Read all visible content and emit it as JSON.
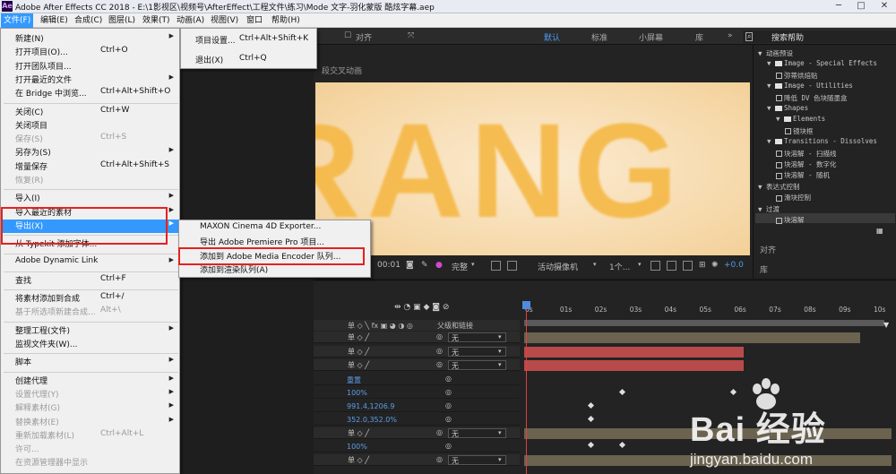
{
  "titlebar": {
    "logo": "Ae",
    "title": "Adobe After Effects CC 2018 - E:\\1影视区\\视频号\\AfterEffect\\工程文件\\练习\\Mode 文字-羽化蒙版 酷炫字幕.aep",
    "min": "─",
    "max": "□",
    "close": "✕"
  },
  "menubar": [
    "文件(F)",
    "编辑(E)",
    "合成(C)",
    "图层(L)",
    "效果(T)",
    "动画(A)",
    "视图(V)",
    "窗口",
    "帮助(H)"
  ],
  "toolbar": {
    "align": "对齐",
    "workspaces": [
      "默认",
      "标准",
      "小屏幕",
      "库"
    ],
    "search_placeholder": "搜索帮助"
  },
  "comp": {
    "title": "段交叉动画",
    "canvas_text": "RANG",
    "footer": {
      "time": "00:01",
      "quality": "完整",
      "camera": "活动摄像机",
      "view": "1个...",
      "exposure": "+0.0"
    }
  },
  "right_panel": {
    "items": [
      {
        "text": "▼ 动画预设",
        "level": 0,
        "kind": "none"
      },
      {
        "text": "Image - Special Effects",
        "level": 1,
        "kind": "folder",
        "arrow": "▼"
      },
      {
        "text": "弥蒂烘焙贴",
        "level": 2,
        "kind": "preset"
      },
      {
        "text": "Image - Utilities",
        "level": 1,
        "kind": "folder",
        "arrow": "▼"
      },
      {
        "text": "降低 DV 色块随墨盒",
        "level": 2,
        "kind": "preset"
      },
      {
        "text": "Shapes",
        "level": 1,
        "kind": "folder",
        "arrow": "▼"
      },
      {
        "text": "Elements",
        "level": 2,
        "kind": "folder",
        "arrow": "▼"
      },
      {
        "text": "镜块框",
        "level": 3,
        "kind": "preset"
      },
      {
        "text": "Transitions - Dissolves",
        "level": 1,
        "kind": "folder",
        "arrow": "▼"
      },
      {
        "text": "块溶解 - 扫描线",
        "level": 2,
        "kind": "preset"
      },
      {
        "text": "块溶解 - 数字化",
        "level": 2,
        "kind": "preset"
      },
      {
        "text": "块溶解 - 随机",
        "level": 2,
        "kind": "preset"
      },
      {
        "text": "▼ 表达式控制",
        "level": 0,
        "kind": "none"
      },
      {
        "text": "滑块控制",
        "level": 2,
        "kind": "preset"
      },
      {
        "text": "▼ 过渡",
        "level": 0,
        "kind": "none"
      },
      {
        "text": "块溶解",
        "level": 2,
        "kind": "preset"
      }
    ],
    "align_label": "对齐",
    "library_label": "库"
  },
  "timeline": {
    "header_parent": "父级和链接",
    "ticks": [
      "0s",
      "01s",
      "02s",
      "03s",
      "04s",
      "05s",
      "06s",
      "07s",
      "08s",
      "09s",
      "10s"
    ],
    "rows": [
      {
        "kind": "layer",
        "parent": "无"
      },
      {
        "kind": "layer",
        "parent": "无"
      },
      {
        "kind": "layer",
        "parent": "无"
      },
      {
        "kind": "prop",
        "value": "重置"
      },
      {
        "kind": "prop",
        "value": "100%"
      },
      {
        "kind": "prop",
        "value": "991.4,1206.9"
      },
      {
        "kind": "prop",
        "value": "352.0,352.0%"
      },
      {
        "kind": "layer",
        "parent": "无"
      },
      {
        "kind": "prop",
        "value": "100%"
      },
      {
        "kind": "layer",
        "parent": "无"
      }
    ]
  },
  "file_menu": {
    "items": [
      {
        "label": "新建(N)",
        "shortcut": "",
        "arrow": true,
        "disabled": false
      },
      {
        "label": "打开项目(O)...",
        "shortcut": "Ctrl+O",
        "arrow": false,
        "disabled": false
      },
      {
        "label": "打开团队项目...",
        "shortcut": "",
        "arrow": false,
        "disabled": false
      },
      {
        "label": "打开最近的文件",
        "shortcut": "",
        "arrow": true,
        "disabled": false
      },
      {
        "label": "在 Bridge 中浏览...",
        "shortcut": "Ctrl+Alt+Shift+O",
        "arrow": false,
        "disabled": false
      },
      {
        "sep": true
      },
      {
        "label": "关闭(C)",
        "shortcut": "Ctrl+W",
        "arrow": false,
        "disabled": false
      },
      {
        "label": "关闭项目",
        "shortcut": "",
        "arrow": false,
        "disabled": false
      },
      {
        "label": "保存(S)",
        "shortcut": "Ctrl+S",
        "arrow": false,
        "disabled": true
      },
      {
        "label": "另存为(S)",
        "shortcut": "",
        "arrow": true,
        "disabled": false
      },
      {
        "label": "增量保存",
        "shortcut": "Ctrl+Alt+Shift+S",
        "arrow": false,
        "disabled": false
      },
      {
        "label": "恢复(R)",
        "shortcut": "",
        "arrow": false,
        "disabled": true
      },
      {
        "sep": true
      },
      {
        "label": "导入(I)",
        "shortcut": "",
        "arrow": true,
        "disabled": false
      },
      {
        "label": "导入最近的素材",
        "shortcut": "",
        "arrow": true,
        "disabled": false
      },
      {
        "label": "导出(X)",
        "shortcut": "",
        "arrow": true,
        "disabled": false,
        "highlight": true
      },
      {
        "sep": true
      },
      {
        "label": "从 Typekit 添加字体...",
        "shortcut": "",
        "arrow": false,
        "disabled": false
      },
      {
        "sep": true
      },
      {
        "label": "Adobe Dynamic Link",
        "shortcut": "",
        "arrow": true,
        "disabled": false
      },
      {
        "sep": true
      },
      {
        "label": "查找",
        "shortcut": "Ctrl+F",
        "arrow": false,
        "disabled": false
      },
      {
        "sep": true
      },
      {
        "label": "将素材添加到合成",
        "shortcut": "Ctrl+/",
        "arrow": false,
        "disabled": false
      },
      {
        "label": "基于所选项新建合成...",
        "shortcut": "Alt+\\",
        "arrow": false,
        "disabled": true
      },
      {
        "sep": true
      },
      {
        "label": "整理工程(文件)",
        "shortcut": "",
        "arrow": true,
        "disabled": false
      },
      {
        "label": "监视文件夹(W)...",
        "shortcut": "",
        "arrow": false,
        "disabled": false
      },
      {
        "sep": true
      },
      {
        "label": "脚本",
        "shortcut": "",
        "arrow": true,
        "disabled": false
      },
      {
        "sep": true
      },
      {
        "label": "创建代理",
        "shortcut": "",
        "arrow": true,
        "disabled": false
      },
      {
        "label": "设置代理(Y)",
        "shortcut": "",
        "arrow": true,
        "disabled": true
      },
      {
        "label": "解释素材(G)",
        "shortcut": "",
        "arrow": true,
        "disabled": true
      },
      {
        "label": "替换素材(E)",
        "shortcut": "",
        "arrow": true,
        "disabled": true
      },
      {
        "label": "重新加载素材(L)",
        "shortcut": "Ctrl+Alt+L",
        "arrow": false,
        "disabled": true
      },
      {
        "label": "许可...",
        "shortcut": "",
        "arrow": false,
        "disabled": true
      },
      {
        "label": "在资源管理器中显示",
        "shortcut": "",
        "arrow": false,
        "disabled": true
      }
    ]
  },
  "project_menu": {
    "items": [
      {
        "label": "项目设置...",
        "shortcut": "Ctrl+Alt+Shift+K"
      },
      {
        "label": "退出(X)",
        "shortcut": "Ctrl+Q"
      }
    ]
  },
  "export_menu": {
    "items": [
      {
        "label": "MAXON Cinema 4D Exporter..."
      },
      {
        "label": "导出 Adobe Premiere Pro 项目..."
      },
      {
        "label": "添加到 Adobe Media Encoder 队列..."
      },
      {
        "label": "添加到渲染队列(A)"
      }
    ]
  },
  "watermark": {
    "brand": "Bai 经验",
    "url": "jingyan.baidu.com"
  },
  "colors": {
    "highlight": "#3399ff",
    "annotation": "#e8201f",
    "layer_bar": "#b84a4a",
    "text_orange": "#f5b948"
  }
}
